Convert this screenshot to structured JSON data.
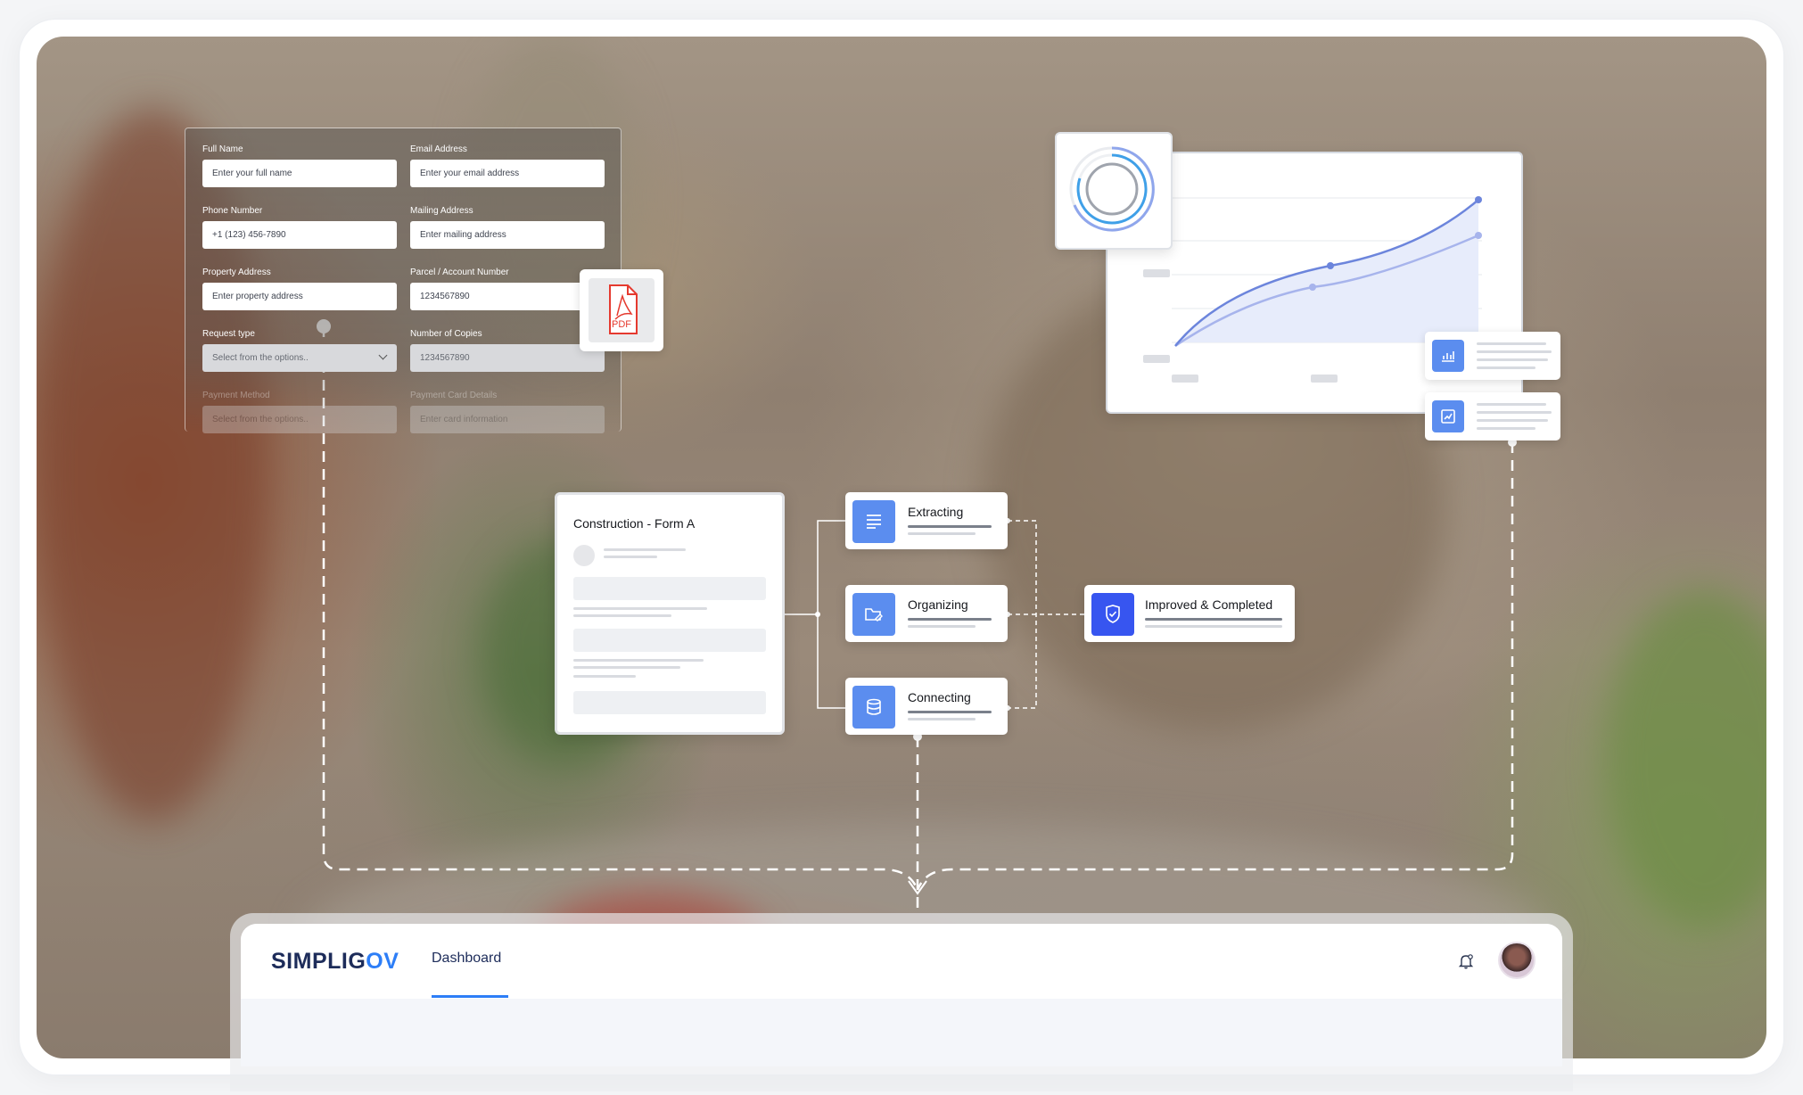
{
  "form": {
    "full_name_label": "Full Name",
    "full_name_placeholder": "Enter your full name",
    "email_label": "Email Address",
    "email_placeholder": "Enter your email address",
    "phone_label": "Phone Number",
    "phone_value": "+1 (123) 456-7890",
    "mailing_label": "Mailing Address",
    "mailing_placeholder": "Enter mailing address",
    "property_label": "Property Address",
    "property_placeholder": "Enter property address",
    "parcel_label": "Parcel / Account Number",
    "parcel_value": "1234567890",
    "request_label": "Request type",
    "request_value": "Select from the options..",
    "copies_label": "Number of Copies",
    "copies_value": "1234567890",
    "payment_method_label": "Payment Method",
    "payment_method_value": "Select from the options..",
    "payment_card_label": "Payment Card Details",
    "payment_card_value": "Enter card information"
  },
  "pdf": {
    "label": "PDF"
  },
  "doc": {
    "title": "Construction - Form A"
  },
  "steps": {
    "extracting": "Extracting",
    "organizing": "Organizing",
    "connecting": "Connecting",
    "completed": "Improved & Completed"
  },
  "dashboard": {
    "logo_main": "SIMPLIG",
    "logo_accent": "OV",
    "tab": "Dashboard"
  },
  "colors": {
    "accent_blue": "#5b8def",
    "deep_blue": "#3755f0",
    "brand_navy": "#1d2c5a"
  }
}
